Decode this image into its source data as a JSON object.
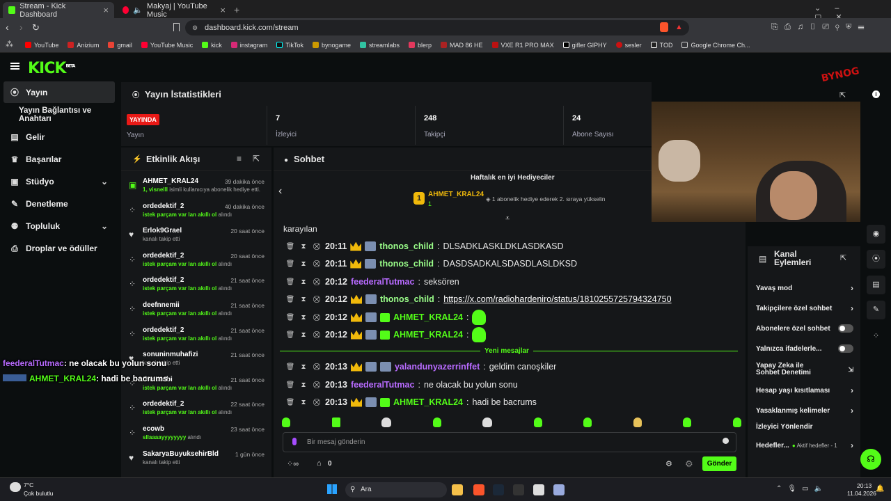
{
  "browser": {
    "tabs": [
      {
        "title": "Stream - Kick Dashboard",
        "active": true
      },
      {
        "title": "Makyaj | YouTube Music",
        "active": false
      }
    ],
    "url": "dashboard.kick.com/stream",
    "bookmarks": [
      "YouTube",
      "Anizium",
      "gmail",
      "YouTube Music",
      "kick",
      "instagram",
      "TikTok",
      "bynogame",
      "streamlabs",
      "blerp",
      "MAD 86 HE",
      "VXE R1 PRO MAX",
      "gifler GIPHY",
      "sesler",
      "TOD",
      "Google Chrome Ch..."
    ]
  },
  "app": {
    "logo": "KICK",
    "logo_beta": "BETA"
  },
  "sidebar": {
    "items": [
      {
        "label": "Yayın",
        "active": true
      },
      {
        "label": "Yayın Bağlantısı ve Anahtarı"
      },
      {
        "label": "Gelir"
      },
      {
        "label": "Başarılar"
      },
      {
        "label": "Stüdyo"
      },
      {
        "label": "Denetleme"
      },
      {
        "label": "Topluluk"
      },
      {
        "label": "Droplar ve ödüller"
      }
    ]
  },
  "stats": {
    "title": "Yayın İstatistikleri",
    "live_badge": "YAYINDA",
    "items": [
      {
        "value": "",
        "label": "Yayın"
      },
      {
        "value": "7",
        "label": "İzleyici"
      },
      {
        "value": "248",
        "label": "Takipçi"
      },
      {
        "value": "24",
        "label": "Abone Sayısı"
      }
    ]
  },
  "feed": {
    "title": "Etkinlik Akışı",
    "rows": [
      {
        "user": "AHMET_KRAL24",
        "time": "39 dakika önce",
        "desc_hl": "1, visnelll",
        "desc": " isimli kullanıcıya abonelik hediye etti."
      },
      {
        "user": "ordedektif_2",
        "time": "40 dakika önce",
        "desc_hl": "istek parçam var lan akıllı ol",
        "desc": " alındı"
      },
      {
        "user": "Erlok9Grael",
        "time": "20 saat önce",
        "desc_hl": "",
        "desc": "kanalı takip etti"
      },
      {
        "user": "ordedektif_2",
        "time": "20 saat önce",
        "desc_hl": "istek parçam var lan akıllı ol",
        "desc": " alındı"
      },
      {
        "user": "ordedektif_2",
        "time": "21 saat önce",
        "desc_hl": "istek parçam var lan akıllı ol",
        "desc": " alındı"
      },
      {
        "user": "deefnnemii",
        "time": "21 saat önce",
        "desc_hl": "istek parçam var lan akıllı ol",
        "desc": " alındı"
      },
      {
        "user": "ordedektif_2",
        "time": "21 saat önce",
        "desc_hl": "istek parçam var lan akıllı ol",
        "desc": " alındı"
      },
      {
        "user": "sonuninmuhafizi",
        "time": "21 saat önce",
        "desc_hl": "",
        "desc": "kanalı takip etti"
      },
      {
        "user": "theturabi",
        "time": "21 saat önce",
        "desc_hl": "istek parçam var lan akıllı ol",
        "desc": " alındı"
      },
      {
        "user": "ordedektif_2",
        "time": "22 saat önce",
        "desc_hl": "istek parçam var lan akıllı ol",
        "desc": " alındı"
      },
      {
        "user": "ecowb",
        "time": "23 saat önce",
        "desc_hl": "sllaaaayyyyyyyy",
        "desc": " alındı"
      },
      {
        "user": "SakaryaBuyuksehirBld",
        "time": "1 gün önce",
        "desc_hl": "",
        "desc": "kanalı takip etti"
      }
    ]
  },
  "chat": {
    "title": "Sohbet",
    "gifters_title": "Haftalık en iyi Hediyeciler",
    "top_gifter": "AHMET_KRAL24",
    "top_gifter_count": "1",
    "gifter_hint": "1 abonelik hediye ederek 2. sıraya yükselin",
    "preview_label": "karayılan",
    "messages": [
      {
        "time": "20:11",
        "user": "thonos_child",
        "text": "DLSADKLASKLDKLASDKASD"
      },
      {
        "time": "20:11",
        "user": "thonos_child",
        "text": "DASDSADKALSDASDLASLDKSD"
      },
      {
        "time": "20:12",
        "user": "feederalTutmac",
        "text": "seksören"
      },
      {
        "time": "20:12",
        "user": "thonos_child",
        "text": "https://x.com/radiohardeniro/status/1810255725794324750"
      },
      {
        "time": "20:12",
        "user": "AHMET_KRAL24",
        "text": ""
      },
      {
        "time": "20:12",
        "user": "AHMET_KRAL24",
        "text": ""
      },
      {
        "time": "20:13",
        "user": "yalandunyazerrinffet",
        "text": "geldim canoşkiler"
      },
      {
        "time": "20:13",
        "user": "feederalTutmac",
        "text": "ne olacak bu yolun sonu"
      },
      {
        "time": "20:13",
        "user": "AHMET_KRAL24",
        "text": "hadi be bacrums"
      }
    ],
    "new_messages": "Yeni mesajlar",
    "input_placeholder": "Bir mesaj gönderin",
    "points": "0",
    "send_label": "Gönder"
  },
  "overlay": {
    "line1_user": "feederalTutmac",
    "line1_text": ": ne olacak bu yolun sonu",
    "line2_user": "AHMET_KRAL24",
    "line2_text": ": hadi be bacrums"
  },
  "actions": {
    "title": "Kanal Eylemleri",
    "items": [
      {
        "label": "Yavaş mod",
        "kind": "chevron"
      },
      {
        "label": "Takipçilere özel sohbet",
        "kind": "chevron"
      },
      {
        "label": "Abonelere özel sohbet",
        "kind": "toggle"
      },
      {
        "label": "Yalnızca ifadelerle...",
        "kind": "toggle"
      },
      {
        "label": "Yapay Zeka ile Sohbet Denetimi",
        "kind": "external"
      },
      {
        "label": "Hesap yaşı kısıtlaması",
        "kind": "chevron"
      },
      {
        "label": "Yasaklanmış kelimeler",
        "kind": "chevron"
      },
      {
        "label": "İzleyici Yönlendir",
        "kind": "none"
      },
      {
        "label": "Hedefler...",
        "kind": "chevron",
        "sub": "Aktif hedefler - 1"
      }
    ]
  },
  "taskbar": {
    "weather_temp": "7°C",
    "weather_desc": "Çok bulutlu",
    "search": "Ara",
    "time": "20:13",
    "date": "11.04.2026"
  },
  "colors": {
    "accent": "#53fc18",
    "live": "#e91916",
    "panel": "#151719"
  }
}
